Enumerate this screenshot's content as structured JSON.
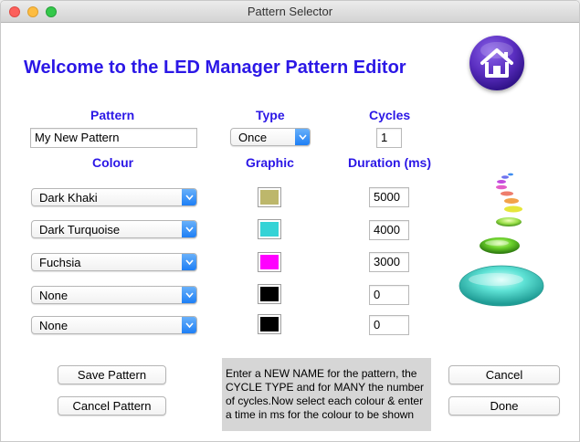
{
  "window": {
    "title": "Pattern Selector"
  },
  "heading": "Welcome to the LED Manager Pattern Editor",
  "labels": {
    "pattern": "Pattern",
    "type": "Type",
    "cycles": "Cycles",
    "colour": "Colour",
    "graphic": "Graphic",
    "duration": "Duration (ms)"
  },
  "pattern_name": "My New Pattern",
  "type_value": "Once",
  "cycles_value": "1",
  "rows": [
    {
      "colour": "Dark Khaki",
      "swatch": "#bdb76b",
      "duration": "5000"
    },
    {
      "colour": "Dark Turquoise",
      "swatch": "#34d3d6",
      "duration": "4000"
    },
    {
      "colour": "Fuchsia",
      "swatch": "#ff00ff",
      "duration": "3000"
    },
    {
      "colour": "None",
      "swatch": "#000000",
      "duration": "0"
    },
    {
      "colour": "None",
      "swatch": "#000000",
      "duration": "0"
    }
  ],
  "buttons": {
    "save_pattern": "Save Pattern",
    "cancel_pattern": "Cancel Pattern",
    "cancel": "Cancel",
    "done": "Done"
  },
  "help_text": "Enter a NEW NAME for the pattern, the CYCLE TYPE and for MANY the number of cycles.Now select each colour & enter a time in ms for the colour to be shown",
  "colors": {
    "accent": "#2b17e6",
    "popup_arrow": "#1a7cf5",
    "help_bg": "#d6d6d6"
  },
  "icons": {
    "logo": "home-icon",
    "decoration": "led-stack-graphic"
  }
}
